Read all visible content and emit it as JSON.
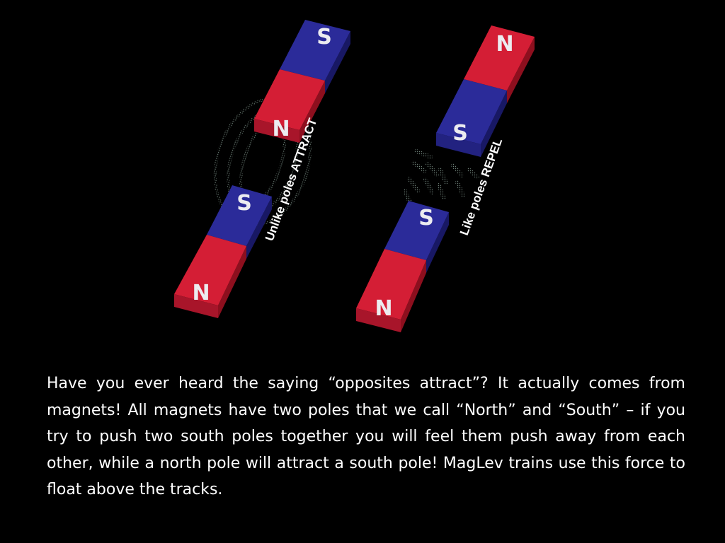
{
  "colors": {
    "background": "#000000",
    "north_face": "#d41e35",
    "north_side": "#8d0f1e",
    "south_face": "#2b2b99",
    "south_side": "#181864",
    "field_lines": "#5a6b62",
    "letter": "#ececf0",
    "text": "#ffffff"
  },
  "diagram": {
    "left_pair": {
      "label": "Unlike poles ATTRACT",
      "top_magnet": {
        "top_pole": "S",
        "bottom_pole": "N"
      },
      "bottom_magnet": {
        "top_pole": "S",
        "bottom_pole": "N"
      }
    },
    "right_pair": {
      "label": "Like poles REPEL",
      "top_magnet": {
        "top_pole": "N",
        "bottom_pole": "S"
      },
      "bottom_magnet": {
        "top_pole": "S",
        "bottom_pole": "N"
      }
    }
  },
  "caption": "Have you ever heard the saying “opposites attract”?  It actually comes from magnets!  All magnets have two poles that we call “North” and “South” – if you try to push two south poles together you will feel them push away from each other, while a north pole will attract a south pole!  MagLev trains use this force to float above the tracks."
}
